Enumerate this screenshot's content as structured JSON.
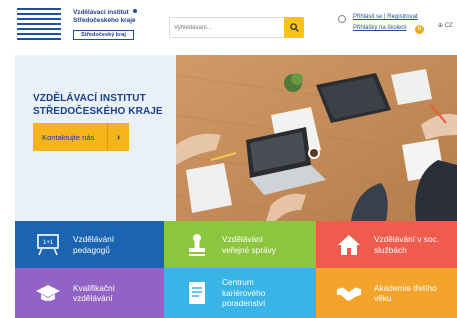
{
  "header": {
    "logo": {
      "line1": "Vzdělávací institut",
      "line2": "Středočeského kraje",
      "badge": "Středočeský kraj"
    },
    "search": {
      "placeholder": "Vyhledávání..."
    },
    "user_link": "Přihlásit se | Registrovat",
    "cart_link": "Přihlášky na školení",
    "cart_count": "0",
    "language": "CZ"
  },
  "hero": {
    "title_line1": "VZDĚLÁVACÍ INSTITUT",
    "title_line2": "STŘEDOČESKÉHO KRAJE",
    "cta_label": "Kontaktujte nás",
    "cta_arrow": "›"
  },
  "tiles": [
    {
      "line1": "Vzdělávání",
      "line2": "pedagogů",
      "line3": "",
      "icon": "whiteboard-icon"
    },
    {
      "line1": "Vzdělávání",
      "line2": "veřejné správy",
      "line3": "",
      "icon": "stamp-icon"
    },
    {
      "line1": "Vzdělávání v soc.",
      "line2": "službách",
      "line3": "",
      "icon": "house-icon"
    },
    {
      "line1": "Kvalifikační",
      "line2": "vzdělávání",
      "line3": "",
      "icon": "graduation-cap-icon"
    },
    {
      "line1": "Centrum",
      "line2": "kariérového",
      "line3": "poradenství",
      "icon": "document-icon"
    },
    {
      "line1": "Akademie třetího",
      "line2": "věku",
      "line3": "",
      "icon": "handshake-icon"
    }
  ],
  "colors": {
    "brand_blue": "#1b3f8b",
    "accent_yellow": "#f4b41a",
    "tile_blue": "#1a64b1",
    "tile_green": "#8cc63f",
    "tile_red": "#ef5b4c",
    "tile_purple": "#9262c5",
    "tile_cyan": "#38b4e6",
    "tile_orange": "#f4a42b"
  }
}
